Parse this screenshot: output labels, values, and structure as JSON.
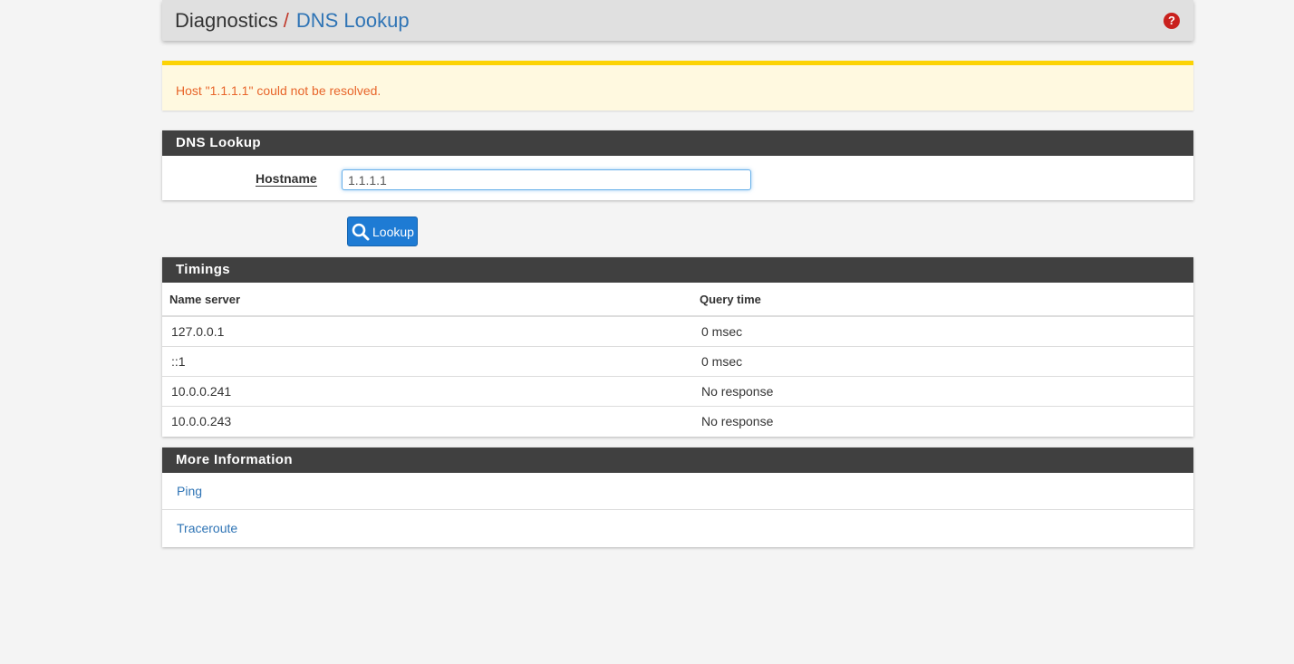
{
  "breadcrumb": {
    "root": "Diagnostics",
    "separator": "/",
    "current": "DNS Lookup"
  },
  "help_icon": "question-circle-icon",
  "alert": {
    "message": "Host \"1.1.1.1\" could not be resolved."
  },
  "dns_panel": {
    "title": "DNS Lookup",
    "hostname_label": "Hostname",
    "hostname_value": "1.1.1.1"
  },
  "lookup_button": {
    "label": "Lookup",
    "icon": "search-icon"
  },
  "timings": {
    "title": "Timings",
    "columns": [
      "Name server",
      "Query time"
    ],
    "rows": [
      [
        "127.0.0.1",
        "0 msec"
      ],
      [
        "::1",
        "0 msec"
      ],
      [
        "10.0.0.241",
        "No response"
      ],
      [
        "10.0.0.243",
        "No response"
      ]
    ]
  },
  "more_info": {
    "title": "More Information",
    "links": [
      "Ping",
      "Traceroute"
    ]
  },
  "colors": {
    "accent": "#2f74b5",
    "button": "#1e7bd4",
    "panel_heading": "#404040",
    "alert_border": "#fcd304",
    "alert_text": "#e8652a",
    "help_icon": "#c9211e"
  }
}
